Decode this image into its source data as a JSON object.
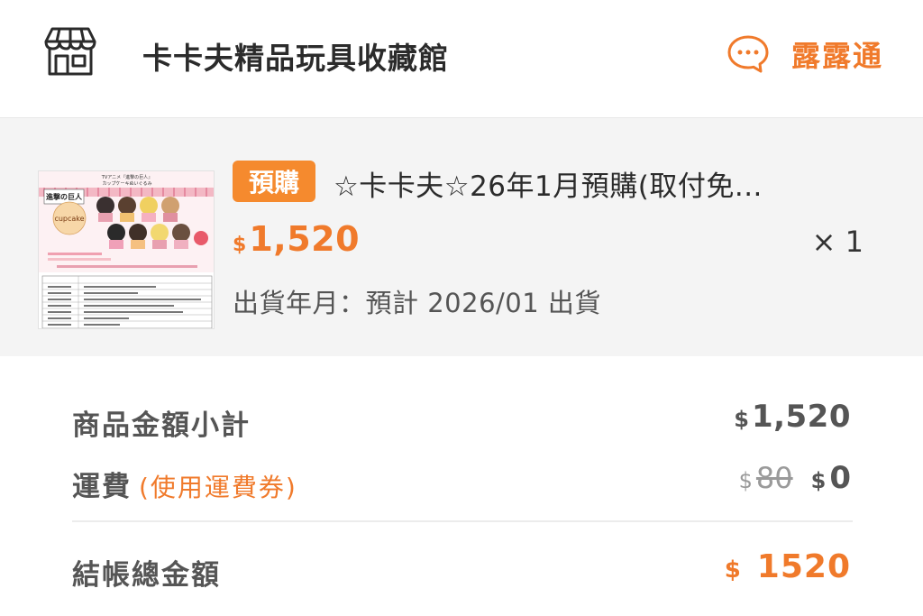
{
  "store": {
    "name": "卡卡夫精品玩具收藏館",
    "icon": "store-icon",
    "chat_label": "露露通",
    "chat_icon": "chat-bubble-icon"
  },
  "item": {
    "badge": "預購",
    "title": "☆卡卡夫☆26年1月預購(取付免...",
    "currency": "$",
    "price": "1,520",
    "quantity": "× 1",
    "ship_date": "出貨年月：預計 2026/01 出貨",
    "thumbnail": {
      "header_text": "TVアニメ『進撃の巨人』",
      "sub_text": "カップケーキぬいぐるみ",
      "logo_text": "進撃の巨人",
      "cupcake_label": "cupcake"
    }
  },
  "summary": {
    "subtotal_label": "商品金額小計",
    "subtotal_currency": "$",
    "subtotal_value": "1,520",
    "shipping_label": "運費",
    "shipping_coupon": "(使用運費券)",
    "shipping_original_currency": "$",
    "shipping_original": "80",
    "shipping_currency": "$",
    "shipping_value": "0",
    "total_label": "結帳總金額",
    "total_currency": "$",
    "total_value": "1520"
  },
  "colors": {
    "accent": "#f07a2b",
    "badge": "#f58a2e",
    "item_bg": "#f4f4f4"
  }
}
